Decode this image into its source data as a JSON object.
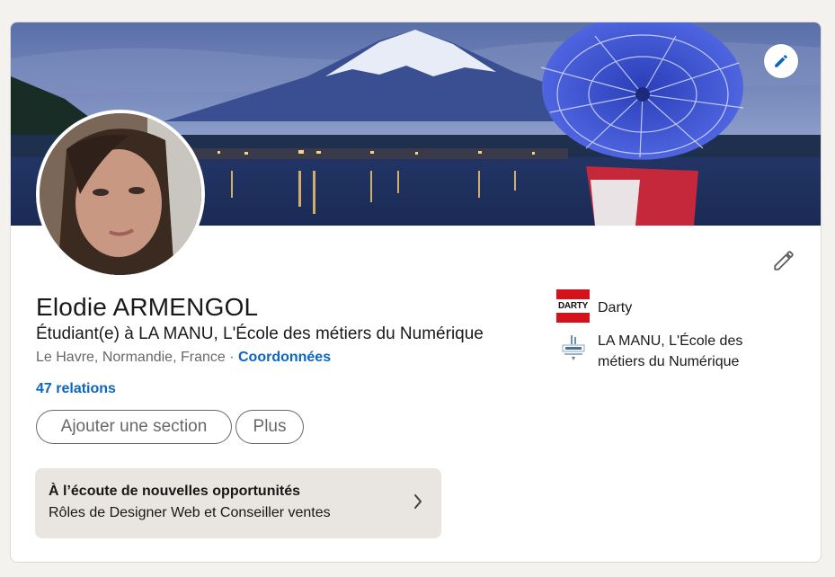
{
  "profile": {
    "name": "Elodie ARMENGOL",
    "headline": "Étudiant(e) à LA MANU, L'École des métiers du Numérique",
    "location": "Le Havre, Normandie, France",
    "separator": " · ",
    "contact_link": "Coordonnées",
    "relations": "47 relations"
  },
  "actions": {
    "add_section": "Ajouter une section",
    "more": "Plus"
  },
  "open_to_work": {
    "title": "À l’écoute de nouvelles opportunités",
    "subtitle": "Rôles de Designer Web et Conseiller ventes"
  },
  "companies": [
    {
      "name": "Darty",
      "logo_text": "DARTY",
      "icon": "darty-logo"
    },
    {
      "name": "LA MANU, L'École des métiers du Numérique",
      "icon": "la-manu-logo"
    }
  ],
  "icons": {
    "banner_edit": "pencil-icon",
    "profile_edit": "pencil-icon",
    "open_to_work_chevron": "chevron-right-icon"
  },
  "colors": {
    "link": "#0a66c2",
    "background": "#f3f2ef",
    "card": "#ffffff",
    "open_to_work_bg": "#e9e6e1",
    "darty_red": "#d5121b"
  }
}
